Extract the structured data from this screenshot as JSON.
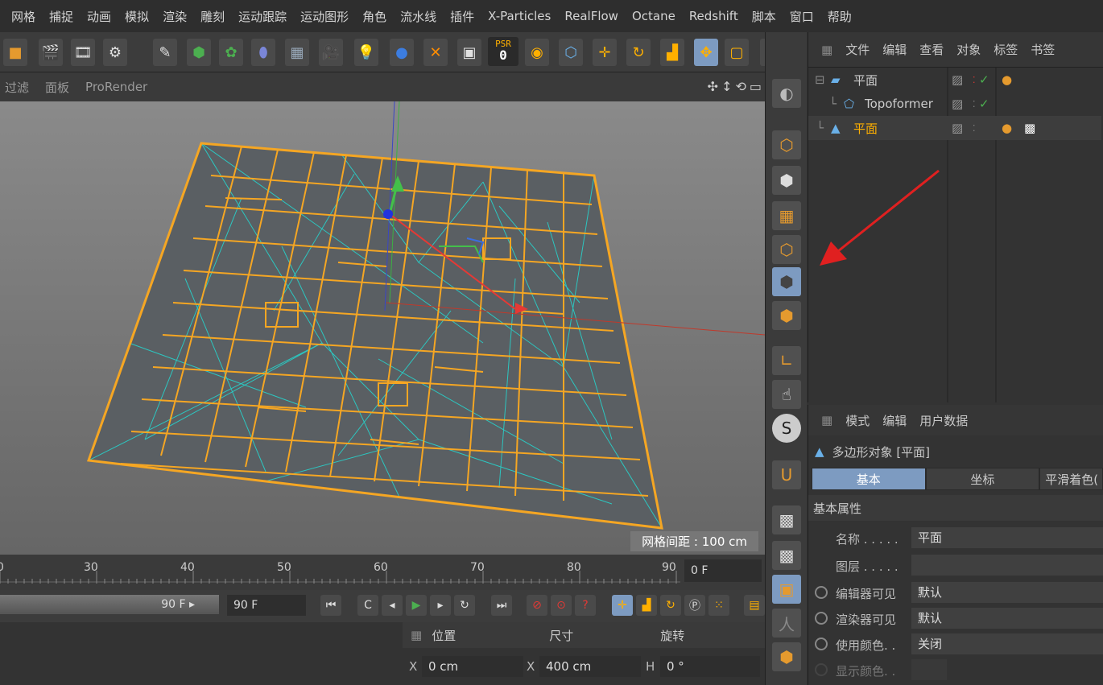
{
  "menubar": {
    "items": [
      "网格",
      "捕捉",
      "动画",
      "模拟",
      "渲染",
      "雕刻",
      "运动跟踪",
      "运动图形",
      "角色",
      "流水线",
      "插件",
      "X-Particles",
      "RealFlow",
      "Octane",
      "Redshift",
      "脚本",
      "窗口",
      "帮助"
    ]
  },
  "toolbar": {
    "psr_label": "PSR",
    "psr_value": "0"
  },
  "viewport": {
    "menu": [
      "过滤",
      "面板",
      "ProRender"
    ],
    "grid_spacing": "网格间距 : 100 cm"
  },
  "object_manager": {
    "menu": [
      "文件",
      "编辑",
      "查看",
      "对象",
      "标签",
      "书签"
    ],
    "objects": [
      {
        "name": "平面",
        "highlight": false
      },
      {
        "name": "Topoformer",
        "highlight": false
      },
      {
        "name": "平面",
        "highlight": true
      }
    ]
  },
  "attributes": {
    "menu": [
      "模式",
      "编辑",
      "用户数据"
    ],
    "title": "多边形对象 [平面]",
    "tabs": [
      "基本",
      "坐标",
      "平滑着色("
    ],
    "section": "基本属性",
    "props": [
      {
        "label": "名称 . . . . .",
        "value": "平面"
      },
      {
        "label": "图层 . . . . .",
        "value": ""
      },
      {
        "label": "编辑器可见",
        "value": "默认"
      },
      {
        "label": "渲染器可见",
        "value": "默认"
      },
      {
        "label": "使用颜色. .",
        "value": "关闭"
      },
      {
        "label": "显示颜色. .",
        "value": ""
      }
    ]
  },
  "timeline": {
    "ticks": [
      "0",
      "30",
      "40",
      "50",
      "60",
      "70",
      "80",
      "90"
    ],
    "current_frame": "0 F"
  },
  "transport": {
    "range_end": "90 F ▸",
    "end_field": "90 F"
  },
  "coords": {
    "headers": [
      "位置",
      "尺寸",
      "旋转"
    ],
    "x_pos": "0 cm",
    "x_size": "400 cm",
    "h_rot": "0 °",
    "x_label": "X",
    "h_label": "H"
  }
}
